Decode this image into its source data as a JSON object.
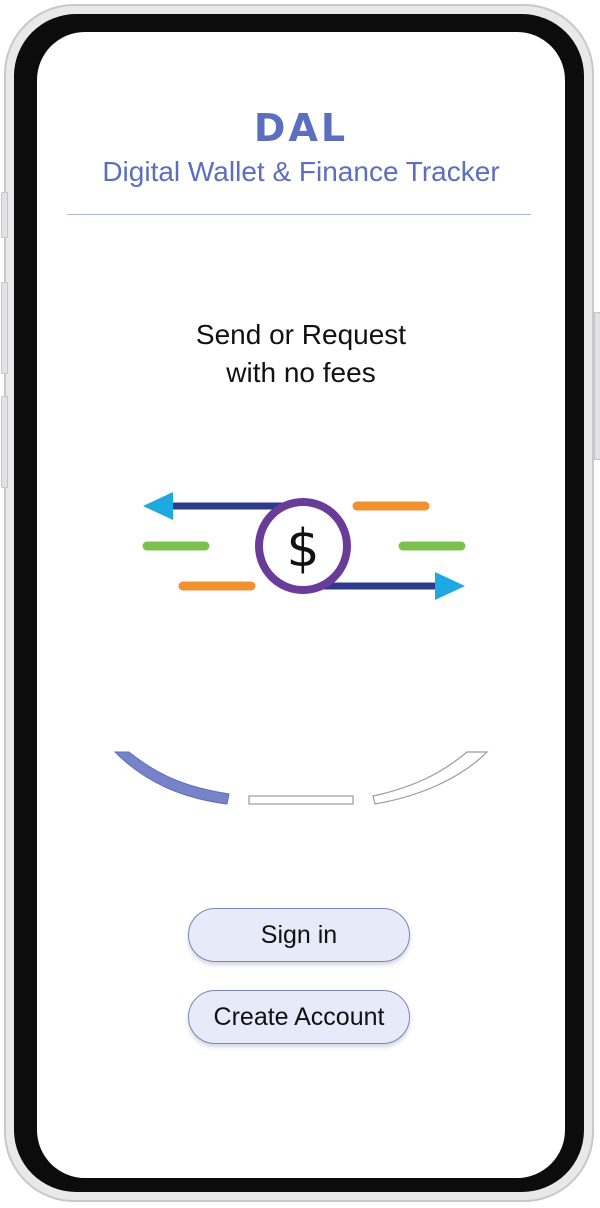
{
  "app": {
    "logo_text": "DAL",
    "subtitle": "Digital Wallet & Finance Tracker"
  },
  "onboarding": {
    "headline_line1": "Send or Request",
    "headline_line2": "with no fees",
    "illustration_icon": "money-transfer-icon",
    "currency_symbol": "$"
  },
  "carousel": {
    "total_slides": 3,
    "active_slide": 1
  },
  "actions": {
    "sign_in_label": "Sign in",
    "create_account_label": "Create Account"
  },
  "colors": {
    "brand": "#5b6ec0",
    "arrow_dark": "#2e3a8c",
    "arrow_head": "#1ea9e1",
    "coin_ring": "#6a3c9a",
    "accent_orange": "#f0912f",
    "accent_green": "#7cc04e",
    "button_fill": "#e7ebf9"
  }
}
